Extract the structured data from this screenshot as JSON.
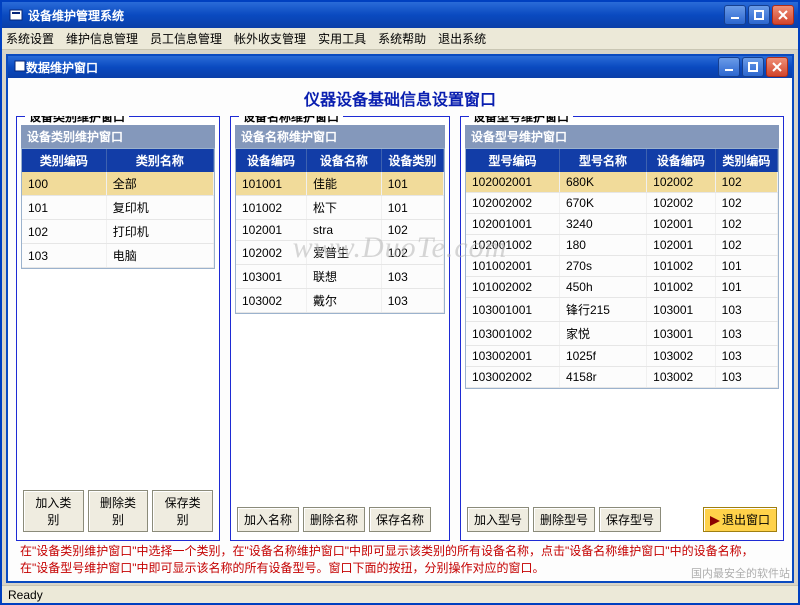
{
  "app": {
    "title": "设备维护管理系统",
    "menus": [
      "系统设置",
      "维护信息管理",
      "员工信息管理",
      "帐外收支管理",
      "实用工具",
      "系统帮助",
      "退出系统"
    ]
  },
  "child": {
    "title": "数据维护窗口",
    "page_title": "仪器设备基础信息设置窗口"
  },
  "panel1": {
    "legend": "设备类别维护窗口",
    "header": "设备类别维护窗口",
    "columns": [
      "类别编码",
      "类别名称"
    ],
    "rows": [
      {
        "code": "100",
        "name": "全部",
        "selected": true
      },
      {
        "code": "101",
        "name": "复印机"
      },
      {
        "code": "102",
        "name": "打印机"
      },
      {
        "code": "103",
        "name": "电脑"
      }
    ],
    "buttons": [
      "加入类别",
      "删除类别",
      "保存类别"
    ]
  },
  "panel2": {
    "legend": "设备名称维护窗口",
    "header": "设备名称维护窗口",
    "columns": [
      "设备编码",
      "设备名称",
      "设备类别"
    ],
    "rows": [
      {
        "code": "101001",
        "name": "佳能",
        "cat": "101",
        "selected": true
      },
      {
        "code": "101002",
        "name": "松下",
        "cat": "101"
      },
      {
        "code": "102001",
        "name": "stra",
        "cat": "102"
      },
      {
        "code": "102002",
        "name": "爱普生",
        "cat": "102"
      },
      {
        "code": "103001",
        "name": "联想",
        "cat": "103"
      },
      {
        "code": "103002",
        "name": "戴尔",
        "cat": "103"
      }
    ],
    "buttons": [
      "加入名称",
      "删除名称",
      "保存名称"
    ]
  },
  "panel3": {
    "legend": "设备型号维护窗口",
    "header": "设备型号维护窗口",
    "columns": [
      "型号编码",
      "型号名称",
      "设备编码",
      "类别编码"
    ],
    "rows": [
      {
        "mcode": "102002001",
        "mname": "680K",
        "dcode": "102002",
        "cat": "102",
        "selected": true
      },
      {
        "mcode": "102002002",
        "mname": "670K",
        "dcode": "102002",
        "cat": "102"
      },
      {
        "mcode": "102001001",
        "mname": "3240",
        "dcode": "102001",
        "cat": "102"
      },
      {
        "mcode": "102001002",
        "mname": "180",
        "dcode": "102001",
        "cat": "102"
      },
      {
        "mcode": "101002001",
        "mname": "270s",
        "dcode": "101002",
        "cat": "101"
      },
      {
        "mcode": "101002002",
        "mname": "450h",
        "dcode": "101002",
        "cat": "101"
      },
      {
        "mcode": "103001001",
        "mname": "锋行215",
        "dcode": "103001",
        "cat": "103"
      },
      {
        "mcode": "103001002",
        "mname": "家悦",
        "dcode": "103001",
        "cat": "103"
      },
      {
        "mcode": "103002001",
        "mname": "1025f",
        "dcode": "103002",
        "cat": "103"
      },
      {
        "mcode": "103002002",
        "mname": "4158r",
        "dcode": "103002",
        "cat": "103"
      }
    ],
    "buttons": [
      "加入型号",
      "删除型号",
      "保存型号"
    ],
    "exit_button": "退出窗口"
  },
  "help_text": "在\"设备类别维护窗口\"中选择一个类别，在\"设备名称维护窗口\"中即可显示该类别的所有设备名称，点击\"设备名称维护窗口\"中的设备名称，在\"设备型号维护窗口\"中即可显示该名称的所有设备型号。窗口下面的按扭，分别操作对应的窗口。",
  "status": "Ready",
  "watermark": "www.DuoTe.com",
  "watermark_br": "国内最安全的软件站"
}
